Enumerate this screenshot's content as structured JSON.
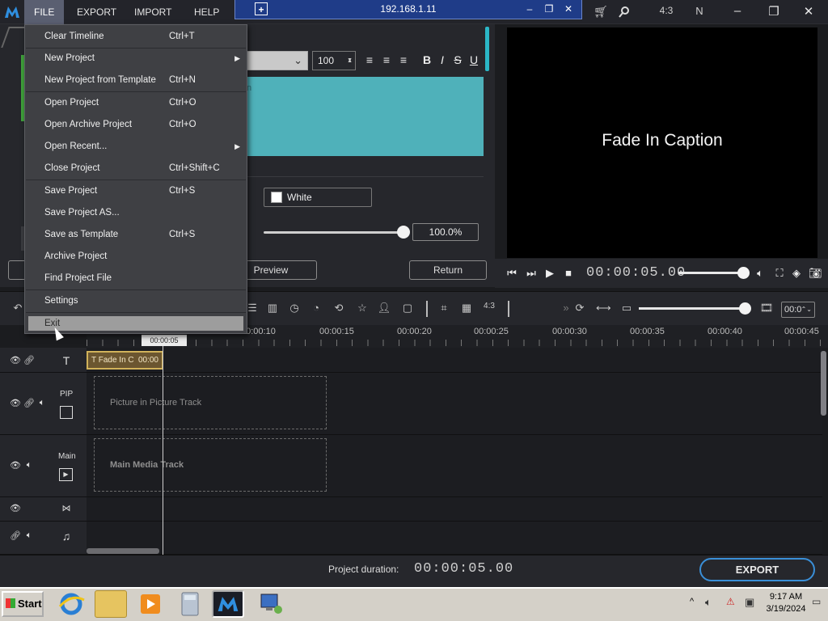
{
  "menubar": {
    "file": "FILE",
    "export": "EXPORT",
    "import": "IMPORT",
    "help": "HELP"
  },
  "remote": {
    "title": "192.168.1.11"
  },
  "aspect_ratio": "4:3",
  "n_label": "N",
  "file_menu": {
    "items": [
      {
        "label": "Clear Timeline",
        "shortcut": "Ctrl+T"
      },
      {
        "label": "New Project",
        "shortcut": ""
      },
      {
        "label": "New Project from Template",
        "shortcut": "Ctrl+N"
      },
      {
        "label": "Open Project",
        "shortcut": "Ctrl+O"
      },
      {
        "label": "Open Archive Project",
        "shortcut": "Ctrl+O"
      },
      {
        "label": "Open Recent...",
        "shortcut": ""
      },
      {
        "label": "Close Project",
        "shortcut": "Ctrl+Shift+C"
      },
      {
        "label": "Save Project",
        "shortcut": "Ctrl+S"
      },
      {
        "label": "Save Project AS...",
        "shortcut": ""
      },
      {
        "label": "Save as Template",
        "shortcut": "Ctrl+S"
      },
      {
        "label": "Archive Project",
        "shortcut": ""
      },
      {
        "label": "Find Project File",
        "shortcut": ""
      },
      {
        "label": "Settings",
        "shortcut": ""
      },
      {
        "label": "Exit",
        "shortcut": ""
      }
    ]
  },
  "text_editor": {
    "font_size": "100",
    "color_name": "White",
    "opacity": "100.0%",
    "preview_label": "Preview",
    "return_label": "Return",
    "caption_stub": "n"
  },
  "preview": {
    "caption": "Fade In Caption",
    "timecode": "00:00:05.00"
  },
  "timeline": {
    "zoom_value": "00:0",
    "playhead": "00:00:05",
    "ticks": [
      "00:00:10",
      "00:00:15",
      "00:00:20",
      "00:00:25",
      "00:00:30",
      "00:00:35",
      "00:00:40",
      "00:00:45"
    ],
    "clip_label": "Fade In C",
    "clip_time": "00:00",
    "pip_label": "PIP",
    "main_label": "Main",
    "pip_placeholder": "Picture in Picture Track",
    "main_placeholder": "Main Media Track"
  },
  "footer": {
    "duration_label": "Project duration:",
    "duration_value": "00:00:05.00",
    "export_label": "EXPORT"
  },
  "taskbar": {
    "start": "Start",
    "time": "9:17 AM",
    "date": "3/19/2024"
  },
  "colors": {
    "accent": "#3a8fd8",
    "caption_bg": "#4fb1ba",
    "clip_border": "#d1b25a"
  }
}
